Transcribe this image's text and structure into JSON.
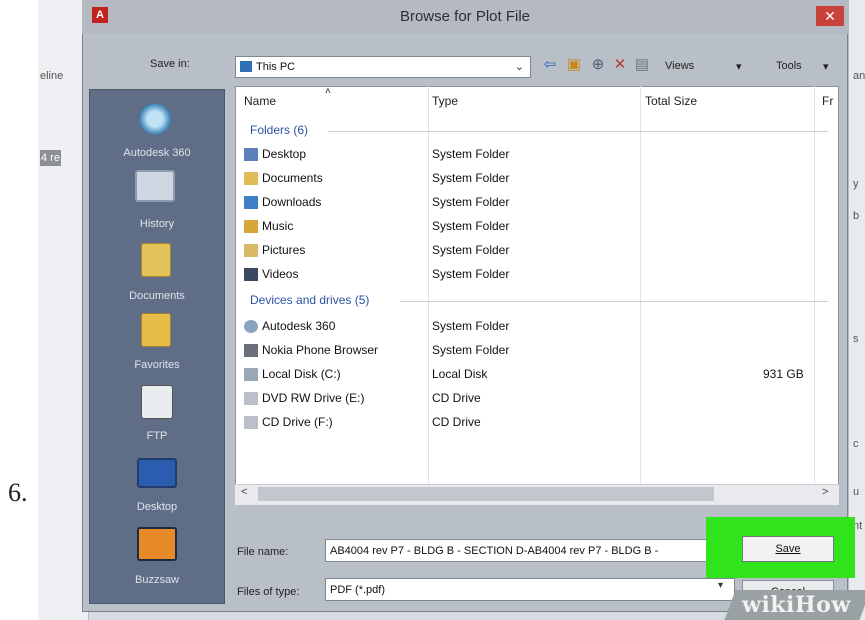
{
  "step": {
    "number": "6."
  },
  "dialog": {
    "title": "Browse for Plot File",
    "save_in": {
      "label": "Save in:",
      "value": "This PC"
    },
    "toolbar": {
      "views": "Views",
      "tools": "Tools"
    },
    "columns": [
      "Name",
      "Type",
      "Total Size",
      "Fr"
    ],
    "places": [
      "Autodesk 360",
      "History",
      "Documents",
      "Favorites",
      "FTP",
      "Desktop",
      "Buzzsaw"
    ],
    "groups": [
      {
        "header": "Folders (6)",
        "rows": [
          {
            "name": "Desktop",
            "type": "System Folder",
            "size": ""
          },
          {
            "name": "Documents",
            "type": "System Folder",
            "size": ""
          },
          {
            "name": "Downloads",
            "type": "System Folder",
            "size": ""
          },
          {
            "name": "Music",
            "type": "System Folder",
            "size": ""
          },
          {
            "name": "Pictures",
            "type": "System Folder",
            "size": ""
          },
          {
            "name": "Videos",
            "type": "System Folder",
            "size": ""
          }
        ]
      },
      {
        "header": "Devices and drives (5)",
        "rows": [
          {
            "name": "Autodesk 360",
            "type": "System Folder",
            "size": ""
          },
          {
            "name": "Nokia Phone Browser",
            "type": "System Folder",
            "size": ""
          },
          {
            "name": "Local Disk (C:)",
            "type": "Local Disk",
            "size": "931 GB"
          },
          {
            "name": "DVD RW Drive (E:)",
            "type": "CD Drive",
            "size": ""
          },
          {
            "name": "CD Drive (F:)",
            "type": "CD Drive",
            "size": ""
          }
        ]
      }
    ],
    "file_name": {
      "label": "File name:",
      "value": "AB4004 rev P7 - BLDG B - SECTION D-AB4004 rev P7 - BLDG B -"
    },
    "file_type": {
      "label": "Files of type:",
      "value": "PDF (*.pdf)"
    },
    "buttons": {
      "save": "Save",
      "cancel": "Cancel"
    }
  },
  "background": {
    "left_fragments": [
      "eline",
      "4 re"
    ],
    "right_fragments": [
      "an",
      "y",
      "b",
      "s",
      "c",
      "u",
      "nt"
    ]
  },
  "watermark": "wikiHow",
  "colors": {
    "highlight": "#31e31a",
    "places_bar": "#5f6e86",
    "close": "#c9413b",
    "group_header": "#2b52a3"
  }
}
